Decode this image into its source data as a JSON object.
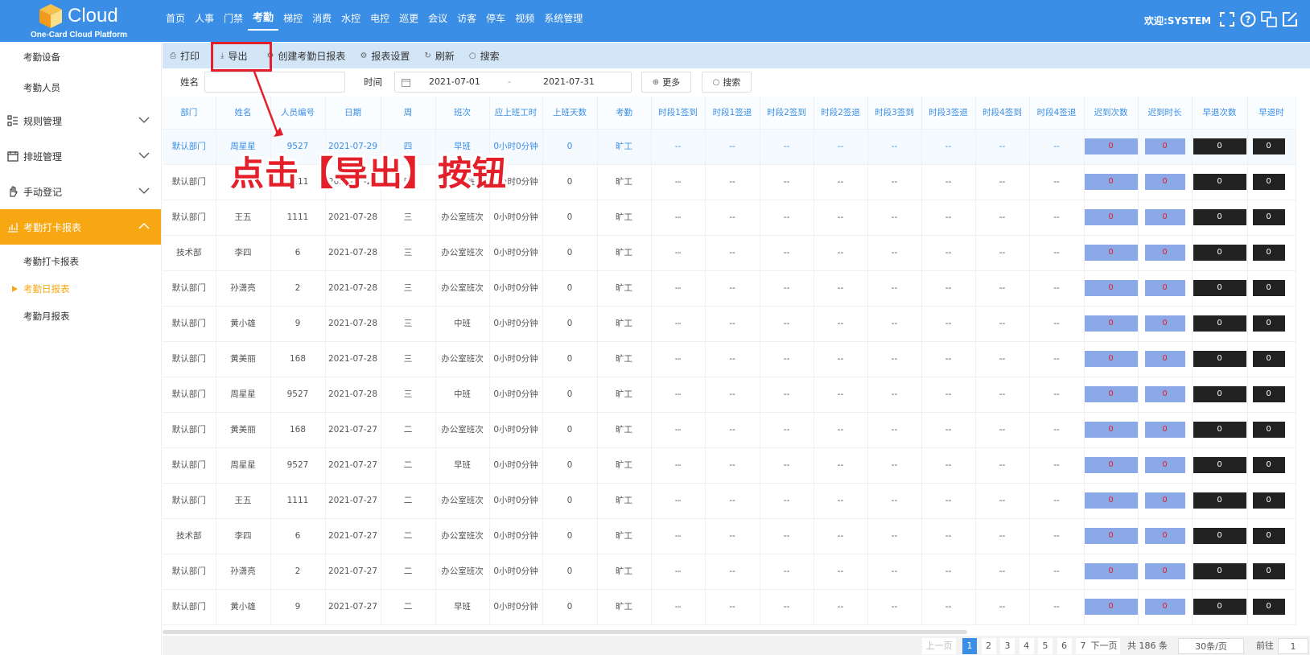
{
  "app": {
    "logo_text": "Cloud",
    "logo_sub": "One-Card Cloud Platform",
    "welcome": "欢迎:SYSTEM"
  },
  "nav": [
    "首页",
    "人事",
    "门禁",
    "考勤",
    "梯控",
    "消费",
    "水控",
    "电控",
    "巡更",
    "会议",
    "访客",
    "停车",
    "视频",
    "系统管理"
  ],
  "nav_active": "考勤",
  "sidebar": {
    "top_items": [
      "考勤设备",
      "考勤人员"
    ],
    "groups": [
      {
        "label": "规则管理",
        "icon": "list-icon"
      },
      {
        "label": "排班管理",
        "icon": "calendar-icon"
      },
      {
        "label": "手动登记",
        "icon": "hand-icon"
      }
    ],
    "active_group": {
      "label": "考勤打卡报表",
      "icon": "chart-icon"
    },
    "sub_items": [
      "考勤打卡报表",
      "考勤日报表",
      "考勤月报表"
    ],
    "current_sub": "考勤日报表"
  },
  "toolbar": {
    "print": "打印",
    "export": "导出",
    "create": "创建考勤日报表",
    "settings": "报表设置",
    "refresh": "刷新",
    "search": "搜索"
  },
  "filters": {
    "name_label": "姓名",
    "time_label": "时间",
    "date_from": "2021-07-01",
    "date_sep": "-",
    "date_to": "2021-07-31",
    "more": "更多",
    "search": "搜索"
  },
  "columns": [
    "部门",
    "姓名",
    "人员编号",
    "日期",
    "周",
    "班次",
    "应上班工时",
    "上班天数",
    "考勤",
    "时段1签到",
    "时段1签退",
    "时段2签到",
    "时段2签退",
    "时段3签到",
    "时段3签退",
    "时段4签到",
    "时段4签退",
    "迟到次数",
    "迟到时长",
    "早退次数",
    "早退时"
  ],
  "rows": [
    {
      "dept": "默认部门",
      "name": "周星星",
      "id": "9527",
      "date": "2021-07-29",
      "wk": "四",
      "shift": "早班",
      "hours": "0小时0分钟",
      "days": "0",
      "status": "旷工"
    },
    {
      "dept": "默认部门",
      "name": "王五",
      "id": "1111",
      "date": "2021-07-29",
      "wk": "四",
      "shift": "办公室班次",
      "hours": "0小时0分钟",
      "days": "0",
      "status": "旷工"
    },
    {
      "dept": "默认部门",
      "name": "王五",
      "id": "1111",
      "date": "2021-07-28",
      "wk": "三",
      "shift": "办公室班次",
      "hours": "0小时0分钟",
      "days": "0",
      "status": "旷工"
    },
    {
      "dept": "技术部",
      "name": "李四",
      "id": "6",
      "date": "2021-07-28",
      "wk": "三",
      "shift": "办公室班次",
      "hours": "0小时0分钟",
      "days": "0",
      "status": "旷工"
    },
    {
      "dept": "默认部门",
      "name": "孙潇亮",
      "id": "2",
      "date": "2021-07-28",
      "wk": "三",
      "shift": "办公室班次",
      "hours": "0小时0分钟",
      "days": "0",
      "status": "旷工"
    },
    {
      "dept": "默认部门",
      "name": "黄小雄",
      "id": "9",
      "date": "2021-07-28",
      "wk": "三",
      "shift": "中班",
      "hours": "0小时0分钟",
      "days": "0",
      "status": "旷工"
    },
    {
      "dept": "默认部门",
      "name": "黄美丽",
      "id": "168",
      "date": "2021-07-28",
      "wk": "三",
      "shift": "办公室班次",
      "hours": "0小时0分钟",
      "days": "0",
      "status": "旷工"
    },
    {
      "dept": "默认部门",
      "name": "周星星",
      "id": "9527",
      "date": "2021-07-28",
      "wk": "三",
      "shift": "中班",
      "hours": "0小时0分钟",
      "days": "0",
      "status": "旷工"
    },
    {
      "dept": "默认部门",
      "name": "黄美丽",
      "id": "168",
      "date": "2021-07-27",
      "wk": "二",
      "shift": "办公室班次",
      "hours": "0小时0分钟",
      "days": "0",
      "status": "旷工"
    },
    {
      "dept": "默认部门",
      "name": "周星星",
      "id": "9527",
      "date": "2021-07-27",
      "wk": "二",
      "shift": "早班",
      "hours": "0小时0分钟",
      "days": "0",
      "status": "旷工"
    },
    {
      "dept": "默认部门",
      "name": "王五",
      "id": "1111",
      "date": "2021-07-27",
      "wk": "二",
      "shift": "办公室班次",
      "hours": "0小时0分钟",
      "days": "0",
      "status": "旷工"
    },
    {
      "dept": "技术部",
      "name": "李四",
      "id": "6",
      "date": "2021-07-27",
      "wk": "二",
      "shift": "办公室班次",
      "hours": "0小时0分钟",
      "days": "0",
      "status": "旷工"
    },
    {
      "dept": "默认部门",
      "name": "孙潇亮",
      "id": "2",
      "date": "2021-07-27",
      "wk": "二",
      "shift": "办公室班次",
      "hours": "0小时0分钟",
      "days": "0",
      "status": "旷工"
    },
    {
      "dept": "默认部门",
      "name": "黄小雄",
      "id": "9",
      "date": "2021-07-27",
      "wk": "二",
      "shift": "早班",
      "hours": "0小时0分钟",
      "days": "0",
      "status": "旷工"
    }
  ],
  "dash": "--",
  "zero": "0",
  "pager": {
    "prev": "上一页",
    "pages": [
      "1",
      "2",
      "3",
      "4",
      "5",
      "6",
      "7"
    ],
    "current": "1",
    "next": "下一页",
    "total": "共 186 条",
    "size": "30条/页",
    "goto": "前往",
    "goto_val": "1"
  },
  "annotation": "点击【导出】按钮",
  "colors": {
    "primary": "#3a8ee6",
    "accent": "#f7a712",
    "highlight": "#e3202a"
  }
}
